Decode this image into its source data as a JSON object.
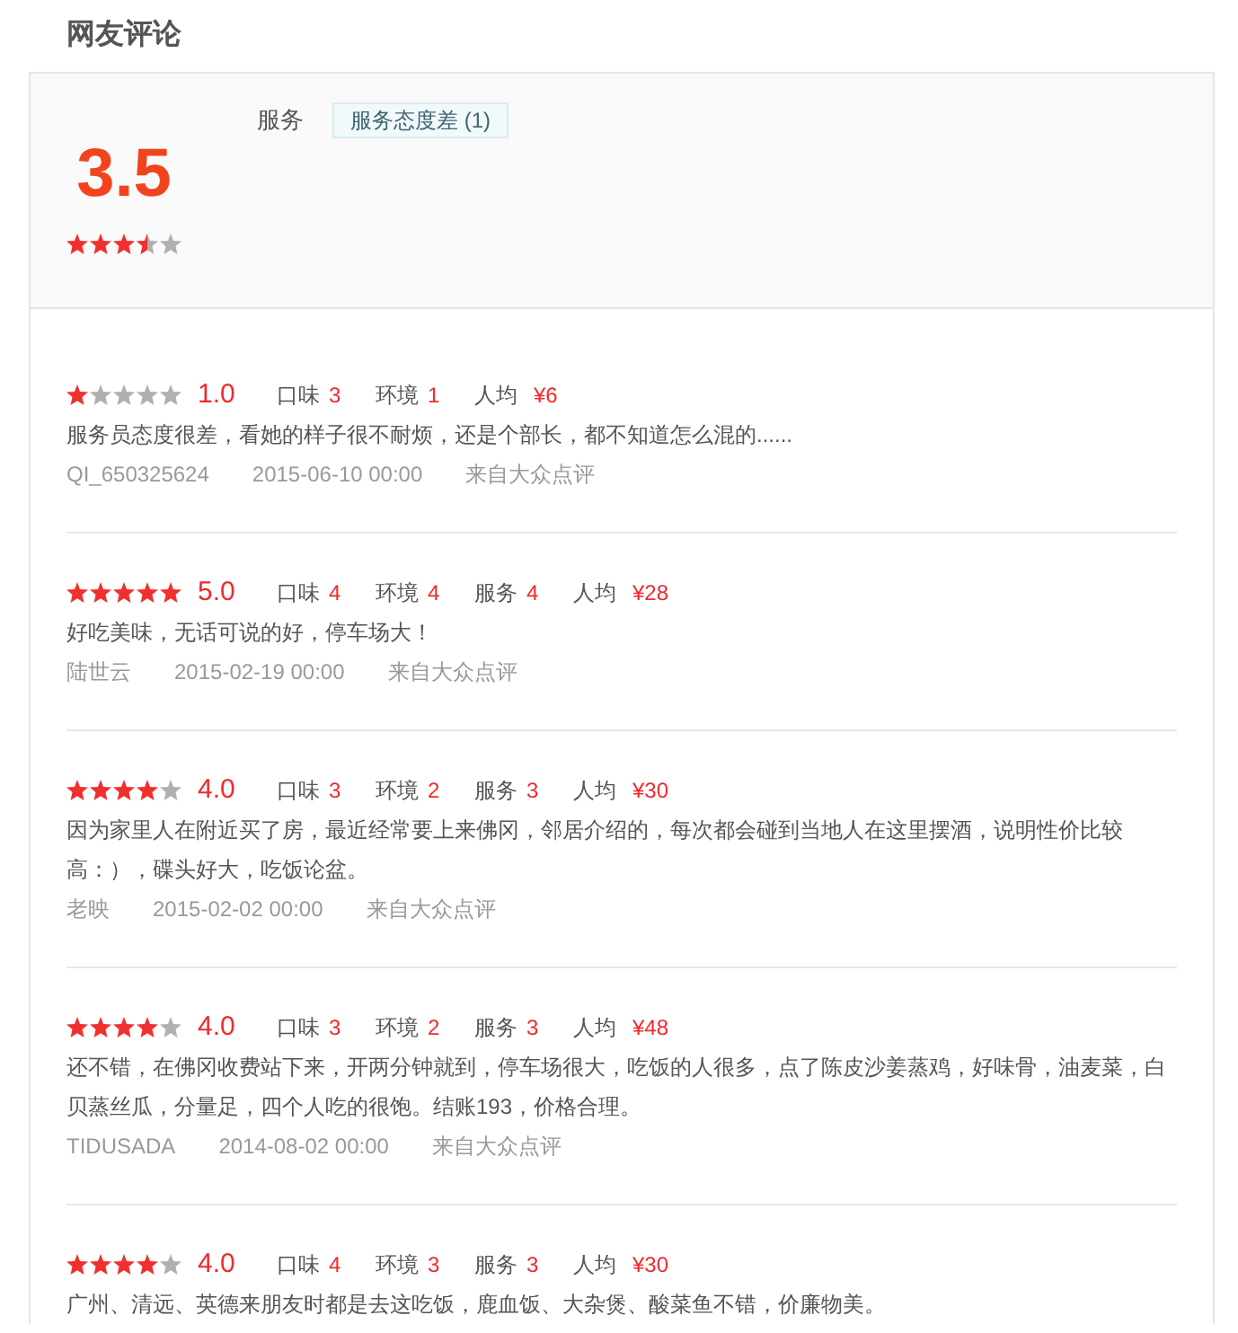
{
  "section_title": "网友评论",
  "summary": {
    "score": "3.5",
    "stars": 3.5,
    "tag_groups": [
      {
        "label": "服务",
        "tags": [
          "服务态度差 (1)"
        ]
      }
    ]
  },
  "reviews": [
    {
      "stars": 1,
      "score": "1.0",
      "ratings": [
        {
          "kind": "score",
          "label": "口味",
          "value": "3"
        },
        {
          "kind": "score",
          "label": "环境",
          "value": "1"
        },
        {
          "kind": "price",
          "label": "人均",
          "value": "¥6"
        }
      ],
      "text": "服务员态度很差，看她的样子很不耐烦，还是个部长，都不知道怎么混的......",
      "user": "QI_650325624",
      "date": "2015-06-10 00:00",
      "source": "来自大众点评"
    },
    {
      "stars": 5,
      "score": "5.0",
      "ratings": [
        {
          "kind": "score",
          "label": "口味",
          "value": "4"
        },
        {
          "kind": "score",
          "label": "环境",
          "value": "4"
        },
        {
          "kind": "score",
          "label": "服务",
          "value": "4"
        },
        {
          "kind": "price",
          "label": "人均",
          "value": "¥28"
        }
      ],
      "text": "好吃美味，无话可说的好，停车场大！",
      "user": "陆世云",
      "date": "2015-02-19 00:00",
      "source": "来自大众点评"
    },
    {
      "stars": 4,
      "score": "4.0",
      "ratings": [
        {
          "kind": "score",
          "label": "口味",
          "value": "3"
        },
        {
          "kind": "score",
          "label": "环境",
          "value": "2"
        },
        {
          "kind": "score",
          "label": "服务",
          "value": "3"
        },
        {
          "kind": "price",
          "label": "人均",
          "value": "¥30"
        }
      ],
      "text": "因为家里人在附近买了房，最近经常要上来佛冈，邻居介绍的，每次都会碰到当地人在这里摆酒，说明性价比较高：），碟头好大，吃饭论盆。",
      "user": "老映",
      "date": "2015-02-02 00:00",
      "source": "来自大众点评"
    },
    {
      "stars": 4,
      "score": "4.0",
      "ratings": [
        {
          "kind": "score",
          "label": "口味",
          "value": "3"
        },
        {
          "kind": "score",
          "label": "环境",
          "value": "2"
        },
        {
          "kind": "score",
          "label": "服务",
          "value": "3"
        },
        {
          "kind": "price",
          "label": "人均",
          "value": "¥48"
        }
      ],
      "text": "还不错，在佛冈收费站下来，开两分钟就到，停车场很大，吃饭的人很多，点了陈皮沙姜蒸鸡，好味骨，油麦菜，白贝蒸丝瓜，分量足，四个人吃的很饱。结账193，价格合理。",
      "user": "TIDUSADA",
      "date": "2014-08-02 00:00",
      "source": "来自大众点评"
    },
    {
      "stars": 4,
      "score": "4.0",
      "ratings": [
        {
          "kind": "score",
          "label": "口味",
          "value": "4"
        },
        {
          "kind": "score",
          "label": "环境",
          "value": "3"
        },
        {
          "kind": "score",
          "label": "服务",
          "value": "3"
        },
        {
          "kind": "price",
          "label": "人均",
          "value": "¥30"
        }
      ],
      "text": "广州、清远、英德来朋友时都是去这吃饭，鹿血饭、大杂煲、酸菜鱼不错，价廉物美。"
    }
  ]
}
